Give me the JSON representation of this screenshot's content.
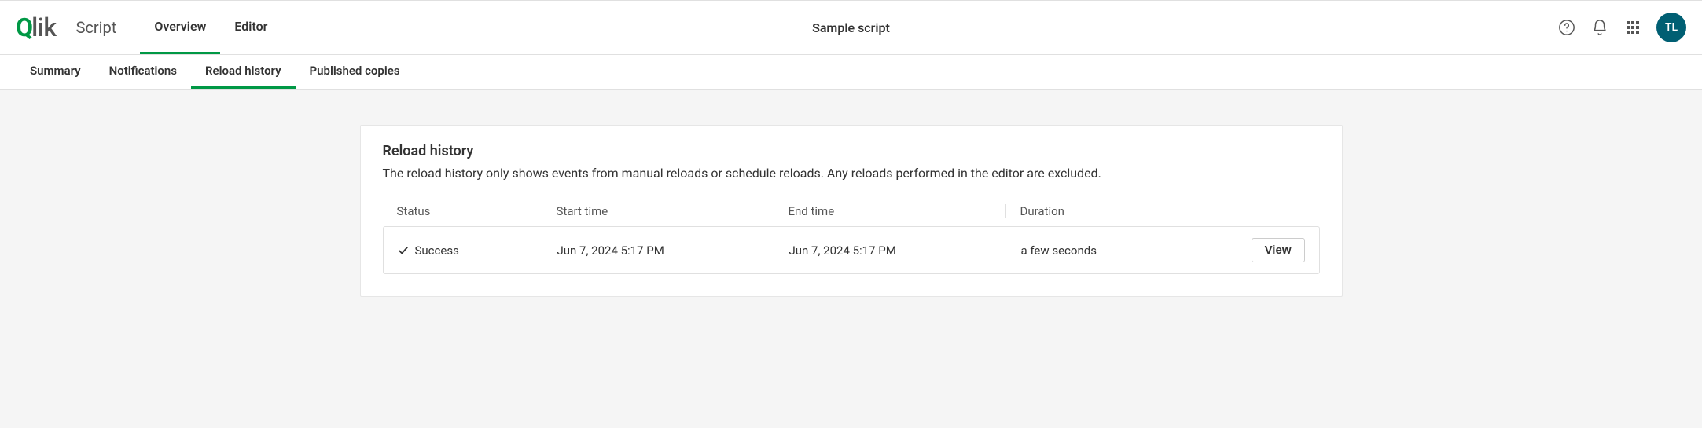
{
  "header": {
    "logo_text": "lik",
    "app_type": "Script",
    "primary_tabs": [
      {
        "label": "Overview",
        "active": true
      },
      {
        "label": "Editor",
        "active": false
      }
    ],
    "page_title": "Sample script",
    "avatar_initials": "TL"
  },
  "sub_nav": {
    "tabs": [
      {
        "label": "Summary",
        "active": false
      },
      {
        "label": "Notifications",
        "active": false
      },
      {
        "label": "Reload history",
        "active": true
      },
      {
        "label": "Published copies",
        "active": false
      }
    ]
  },
  "panel": {
    "title": "Reload history",
    "description": "The reload history only shows events from manual reloads or schedule reloads. Any reloads performed in the editor are excluded.",
    "columns": {
      "status": "Status",
      "start": "Start time",
      "end": "End time",
      "duration": "Duration"
    },
    "rows": [
      {
        "status": "Success",
        "start": "Jun 7, 2024 5:17 PM",
        "end": "Jun 7, 2024 5:17 PM",
        "duration": "a few seconds",
        "action": "View"
      }
    ]
  }
}
